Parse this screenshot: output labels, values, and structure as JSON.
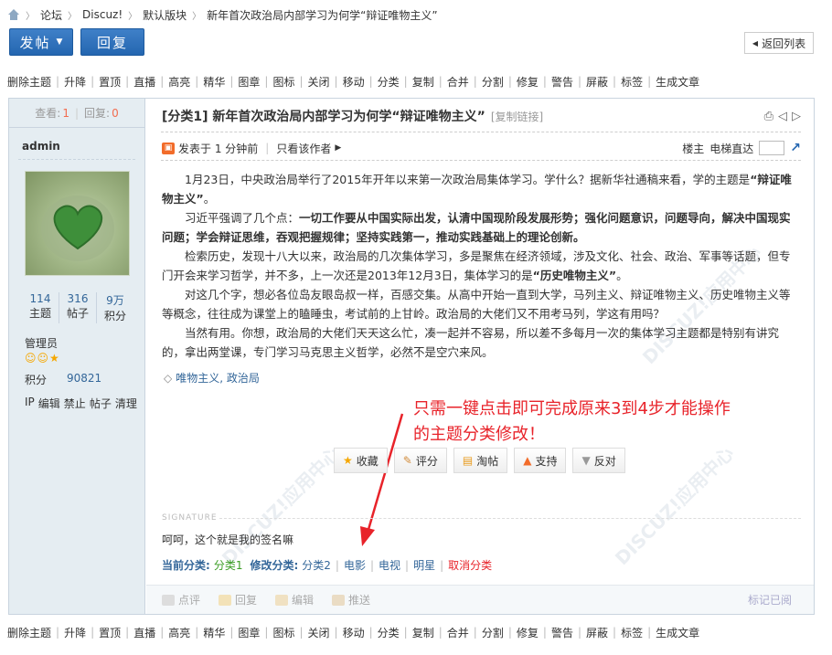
{
  "breadcrumb": [
    "论坛",
    "Discuz!",
    "默认版块",
    "新年首次政治局内部学习为何学“辩证唯物主义”"
  ],
  "toolbar": {
    "post_label": "发帖",
    "reply_label": "回复",
    "back_label": "返回列表"
  },
  "mod_actions": [
    "删除主题",
    "升降",
    "置顶",
    "直播",
    "高亮",
    "精华",
    "图章",
    "图标",
    "关闭",
    "移动",
    "分类",
    "复制",
    "合并",
    "分割",
    "修复",
    "警告",
    "屏蔽",
    "标签",
    "生成文章"
  ],
  "stats": {
    "views_label": "查看:",
    "views": "1",
    "replies_label": "回复:",
    "replies": "0"
  },
  "thread": {
    "title": "[分类1] 新年首次政治局内部学习为何学“辩证唯物主义”",
    "copy_link": "[复制链接]"
  },
  "user": {
    "name": "admin",
    "counts": [
      {
        "value": "114",
        "label": "主题"
      },
      {
        "value": "316",
        "label": "帖子"
      },
      {
        "value": "9万",
        "label": "积分"
      }
    ],
    "group": "管理员",
    "points_label": "积分",
    "points": "90821",
    "actions": [
      "IP",
      "编辑",
      "禁止",
      "帖子",
      "清理"
    ]
  },
  "author_bar": {
    "posted": "发表于 1 分钟前",
    "only_author": "只看该作者",
    "floor": "楼主",
    "jump": "电梯直达"
  },
  "content": {
    "p1a": "1月23日，中央政治局举行了2015年开年以来第一次政治局集体学习。学什么？据新华社通稿来看，学的主题是",
    "p1b": "“辩证唯物主义”",
    "p1c": "。",
    "p2a": "习近平强调了几个点：",
    "p2b": "一切工作要从中国实际出发，认清中国现阶段发展形势；强化问题意识，问题导向，解决中国现实问题；学会辩证思维，吞观把握规律；坚持实践第一，推动实践基础上的理论创新。",
    "p3a": "检索历史，发现十八大以来，政治局的几次集体学习，多是聚焦在经济领域，涉及文化、社会、政治、军事等话题，但专门开会来学习哲学，并不多，上一次还是2013年12月3日，集体学习的是",
    "p3b": "“历史唯物主义”",
    "p3c": "。",
    "p4": "对这几个字，想必各位岛友眼岛叔一样，百感交集。从高中开始一直到大学，马列主义、辩证唯物主义、历史唯物主义等等概念，往往成为课堂上的瞌睡虫，考试前的上甘岭。政治局的大佬们又不用考马列，学这有用吗？",
    "p5": "当然有用。你想，政治局的大佬们天天这么忙，凑一起并不容易，所以差不多每月一次的集体学习主题都是特别有讲究的，拿出两堂课，专门学习马克思主义哲学，必然不是空穴来风。"
  },
  "tags": "唯物主义, 政治局",
  "annotation": {
    "line1": "只需一键点击即可完成原来3到4步才能操作",
    "line2": "的主题分类修改！"
  },
  "post_actions": [
    "收藏",
    "评分",
    "淘帖",
    "支持",
    "反对"
  ],
  "signature_label": "SIGNATURE",
  "signature": "呵呵，这个就是我的签名嘛",
  "classify": {
    "current_label": "当前分类:",
    "current": "分类1",
    "modify_label": "修改分类:",
    "options": [
      "分类2",
      "电影",
      "电视",
      "明星"
    ],
    "cancel": "取消分类"
  },
  "footer_actions": [
    "点评",
    "回复",
    "编辑",
    "推送"
  ],
  "report": "标记已阅",
  "colors": {
    "accent_blue": "#2466b0",
    "link_blue": "#336699",
    "annotation_red": "#e8232a",
    "sidebar_bg": "#e5edf2"
  }
}
